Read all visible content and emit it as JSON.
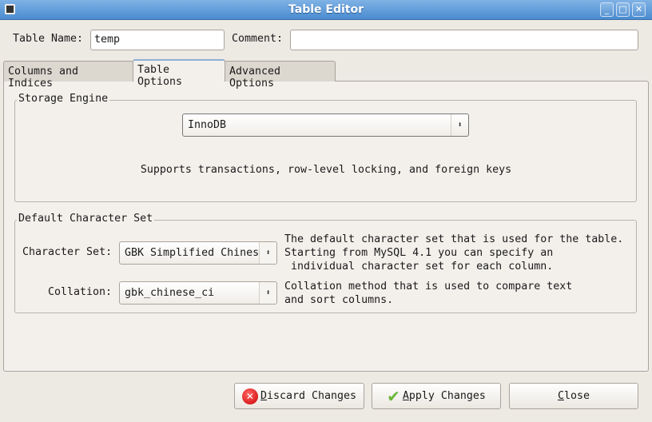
{
  "window": {
    "title": "Table Editor"
  },
  "header": {
    "table_name_label": "Table Name:",
    "table_name_value": "temp",
    "comment_label": "Comment:",
    "comment_value": ""
  },
  "tabs": [
    {
      "label": "Columns and Indices"
    },
    {
      "label": "Table Options"
    },
    {
      "label": "Advanced Options"
    }
  ],
  "storage": {
    "legend": "Storage Engine",
    "engine": "InnoDB",
    "description": "Supports transactions, row-level locking, and foreign keys"
  },
  "charset": {
    "legend": "Default Character Set",
    "charset_label": "Character Set:",
    "charset_value": "GBK Simplified Chinese",
    "charset_desc": "The default character set that is used for the table.\nStarting from MySQL 4.1 you can specify an\n individual character set for each column.",
    "collation_label": "Collation:",
    "collation_value": "gbk_chinese_ci",
    "collation_desc": "Collation method that is used to compare text\nand sort columns."
  },
  "buttons": {
    "discard_first": "D",
    "discard_rest": "iscard Changes",
    "apply_first": "A",
    "apply_rest": "pply Changes",
    "close_first": "C",
    "close_rest": "lose"
  }
}
